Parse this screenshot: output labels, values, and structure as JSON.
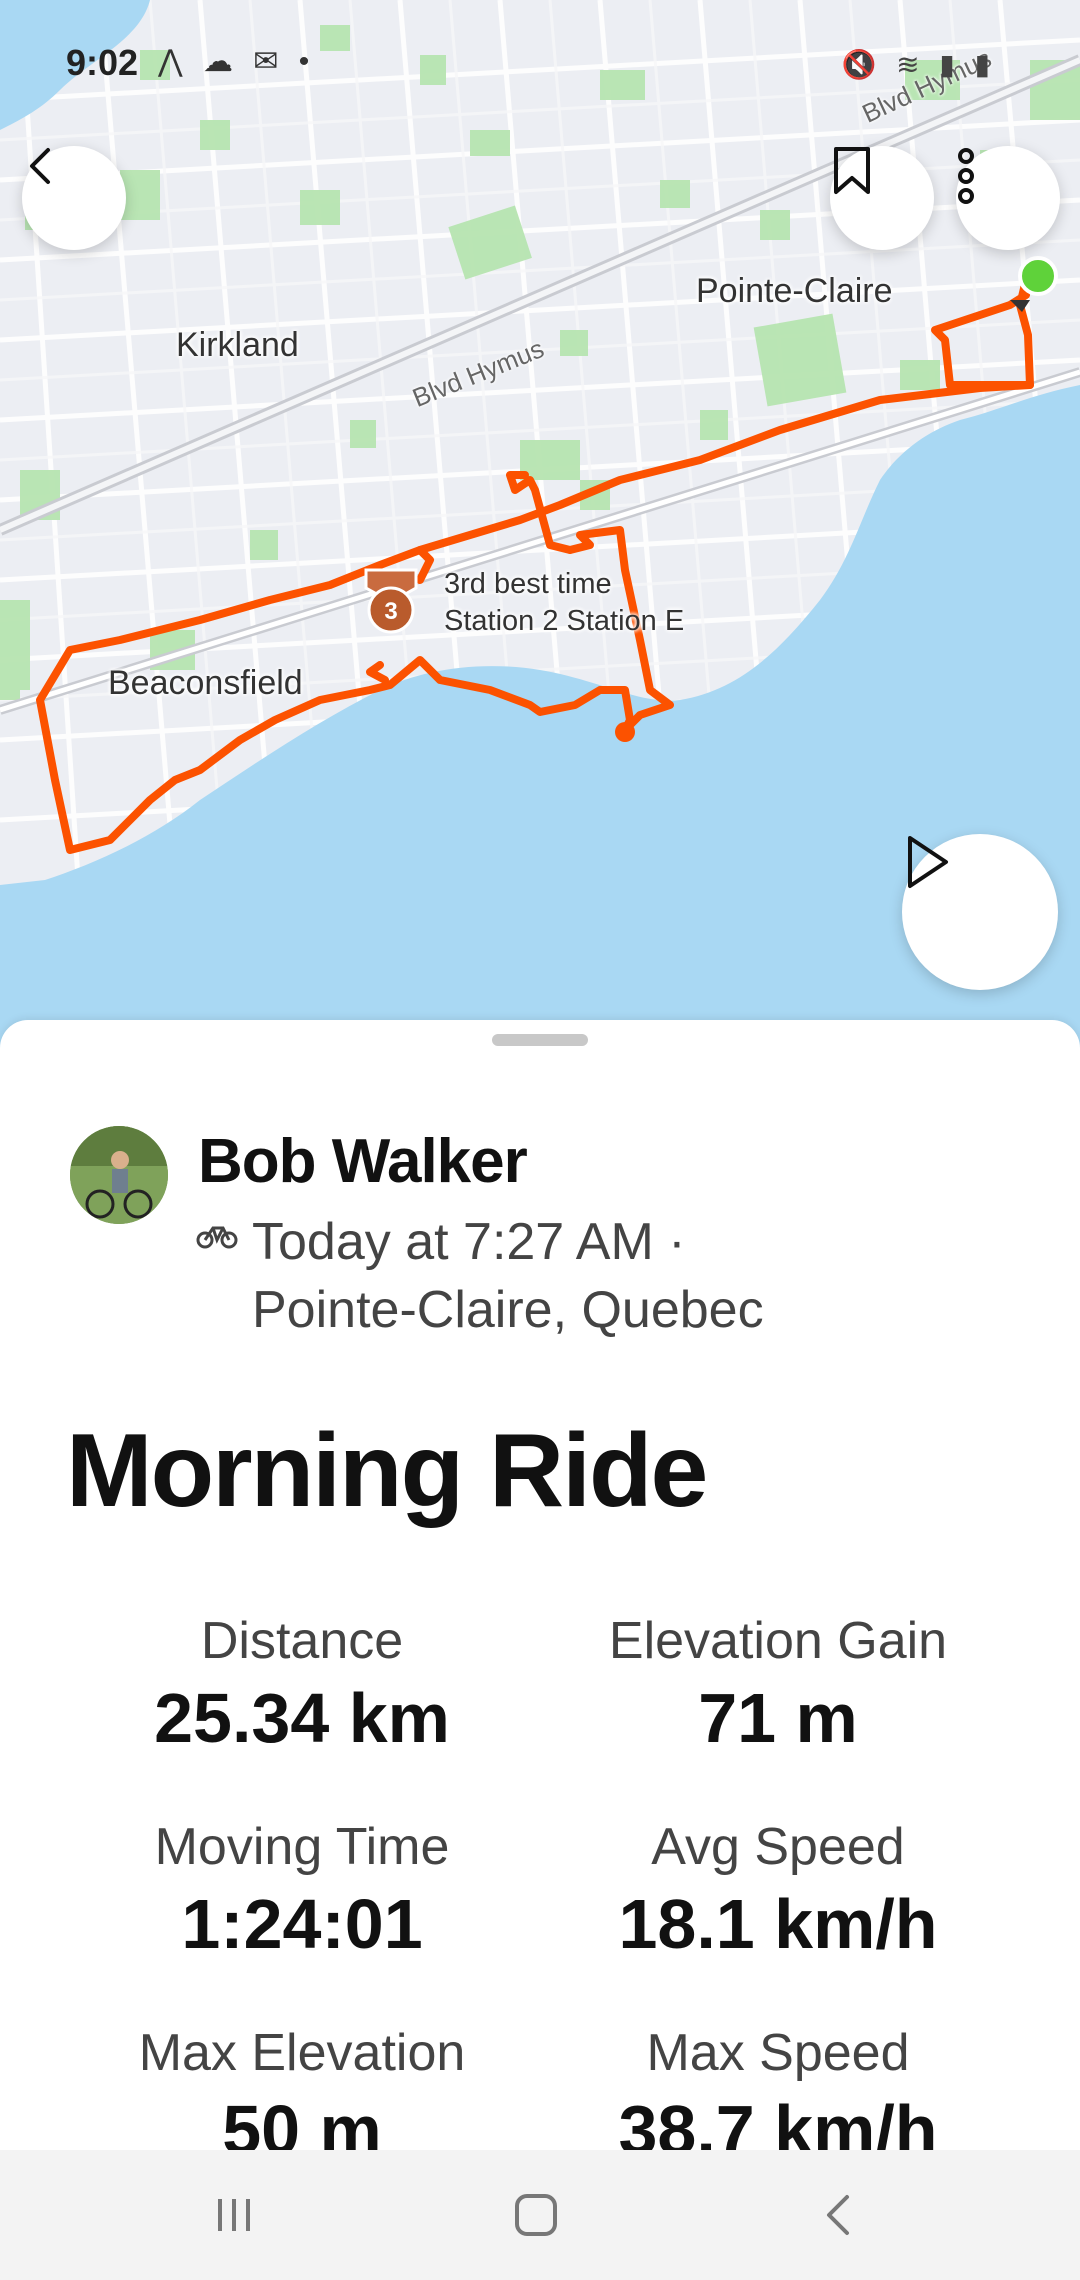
{
  "status_bar": {
    "time": "9:02",
    "left_icons": "⋀ ☁ ✉ •",
    "right_icons": "🔇 ≋ ▮ ▮"
  },
  "map": {
    "place_labels": {
      "pointe_claire": "Pointe-Claire",
      "kirkland": "Kirkland",
      "beaconsfield": "Beaconsfield"
    },
    "road_labels": {
      "hymus_1": "Blvd Hymus",
      "hymus_2": "Blvd Hymus"
    },
    "achievement": {
      "medal_number": "3",
      "line1": "3rd best time",
      "line2": "Station 2 Station E"
    },
    "colors": {
      "route": "#fc5200",
      "water": "#a9d8f3",
      "land": "#eceef3",
      "park": "#b7e4b0",
      "start_marker": "#5fd23a"
    },
    "icons": {
      "back": "chevron-left-icon",
      "bookmark": "bookmark-icon",
      "more": "more-vertical-icon",
      "play": "play-icon"
    }
  },
  "activity": {
    "athlete_name": "Bob Walker",
    "date_line": "Today at 7:27 AM ·",
    "location": "Pointe-Claire, Quebec",
    "title": "Morning Ride",
    "stats": [
      {
        "label": "Distance",
        "value": "25.34 km"
      },
      {
        "label": "Elevation Gain",
        "value": "71 m"
      },
      {
        "label": "Moving Time",
        "value": "1:24:01"
      },
      {
        "label": "Avg Speed",
        "value": "18.1 km/h"
      },
      {
        "label": "Max Elevation",
        "value": "50 m"
      },
      {
        "label": "Max Speed",
        "value": "38.7 km/h"
      }
    ]
  },
  "nav_bar": {
    "icons": [
      "recents-icon",
      "home-icon",
      "back-icon"
    ]
  }
}
